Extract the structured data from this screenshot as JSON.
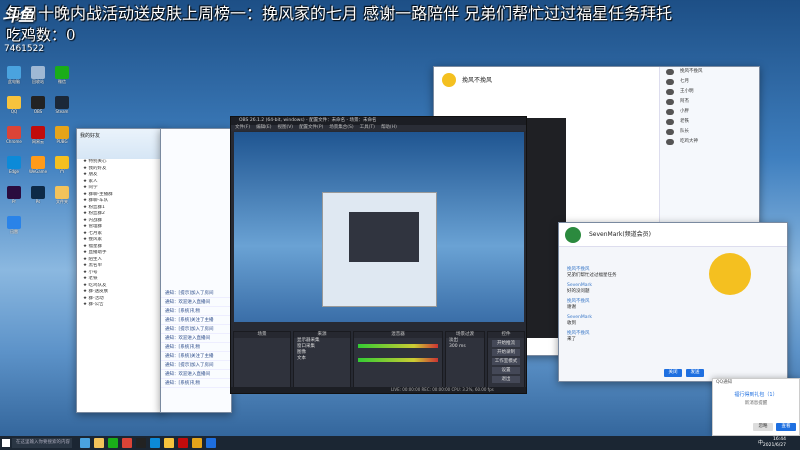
{
  "stream": {
    "ticker": "每日十晚内战活动送皮肤上周榜一：挽风家的七月      感谢一路陪伴  兄弟们帮忙过过福星任务拜托",
    "chicken_count": "吃鸡数：0",
    "logo": "斗鱼",
    "room_id": "7461522"
  },
  "desktop_icons": [
    {
      "label": "此电脑",
      "color": "#4aa3df"
    },
    {
      "label": "回收站",
      "color": "#9fb8d4"
    },
    {
      "label": "微信",
      "color": "#1aad19"
    },
    {
      "label": "QQ",
      "color": "#f7c33d"
    },
    {
      "label": "OBS",
      "color": "#222"
    },
    {
      "label": "Steam",
      "color": "#1b2838"
    },
    {
      "label": "Chrome",
      "color": "#db4437"
    },
    {
      "label": "网易云",
      "color": "#c20c0c"
    },
    {
      "label": "PUBG",
      "color": "#e5a41a"
    },
    {
      "label": "Edge",
      "color": "#0c8ad8"
    },
    {
      "label": "WeGame",
      "color": "#ff9b1a"
    },
    {
      "label": "YY",
      "color": "#f4c020"
    },
    {
      "label": "Pr",
      "color": "#2a0c3f"
    },
    {
      "label": "Ps",
      "color": "#0d2a47"
    },
    {
      "label": "文件夹",
      "color": "#f3c35b"
    },
    {
      "label": "迅雷",
      "color": "#2a83e8"
    }
  ],
  "qq_left": {
    "header": "我的好友",
    "rows": [
      "★ 特别关心",
      "★ 我的好友",
      "★ 朋友",
      "★ 家人",
      "★ 同学",
      "★ 群聊-主播群",
      "★ 群聊-车队",
      "★ 粉丝群1",
      "★ 粉丝群2",
      "★ 内战群",
      "★ 管理群",
      "★ 七月家",
      "★ 挽风家",
      "★ 福星群",
      "★ 直播助手",
      "★ 陌生人",
      "★ 黑名单",
      "★ 小号",
      "★ 老铁",
      "★ 吃鸡队友",
      "★ 群-送皮肤",
      "★ 群-活动",
      "★ 群-公告"
    ]
  },
  "chat_left": {
    "messages": [
      "通知：[提示]加入了房间",
      "通知：欢迎进入直播间",
      "通知：[系统]礼物",
      "通知：[系统]关注了主播",
      "通知：[提示]加入了房间",
      "通知：欢迎进入直播间",
      "通知：[系统]礼物",
      "通知：[系统]关注了主播",
      "通知：[提示]加入了房间",
      "通知：欢迎进入直播间",
      "通知：[系统]礼物"
    ]
  },
  "obs": {
    "title": "OBS 26.1.2 (64-bit, windows) - 配置文件：未命名 - 场景：未命名",
    "menu": [
      "文件(F)",
      "编辑(E)",
      "视图(V)",
      "配置文件(P)",
      "场景集合(S)",
      "工具(T)",
      "帮助(H)"
    ],
    "docks": {
      "scenes": "场景",
      "sources": "来源",
      "mixer": "混音器",
      "transitions": "场景过渡",
      "controls": "控件"
    },
    "sources": [
      "显示器采集",
      "窗口采集",
      "图像",
      "文本"
    ],
    "controls": [
      "开始推流",
      "开始录制",
      "工作室模式",
      "设置",
      "退出"
    ],
    "transition_name": "淡出",
    "duration": "300 ms",
    "status": "LIVE: 00:00:00   REC: 00:00:00   CPU: 3.2%, 60.00 fps"
  },
  "qq_right": {
    "profile_name": "挽风不挽风",
    "contacts": [
      "挽风不挽风",
      "七月",
      "王小明",
      "阿杰",
      "小胖",
      "老铁",
      "队长",
      "吃鸡大神"
    ]
  },
  "chat2": {
    "title": "SevenMark(频道会员)",
    "lines": [
      {
        "who": "挽风不挽风",
        "text": "兄弟们帮忙过过福星任务"
      },
      {
        "who": "SevenMark",
        "text": "好的没问题"
      },
      {
        "who": "挽风不挽风",
        "text": "谢谢"
      },
      {
        "who": "SevenMark",
        "text": "收到"
      },
      {
        "who": "挽风不挽风",
        "text": "来了"
      }
    ],
    "close": "关闭",
    "send": "发送"
  },
  "notification": {
    "header": "QQ通知",
    "title": "福行得到礼包（1）",
    "body": "新消息提醒",
    "btn_ignore": "忽略",
    "btn_view": "查看"
  },
  "taskbar": {
    "search": "在这里输入你要搜索的内容",
    "time": "16:44",
    "date": "2021/6/27",
    "ime": "中"
  }
}
